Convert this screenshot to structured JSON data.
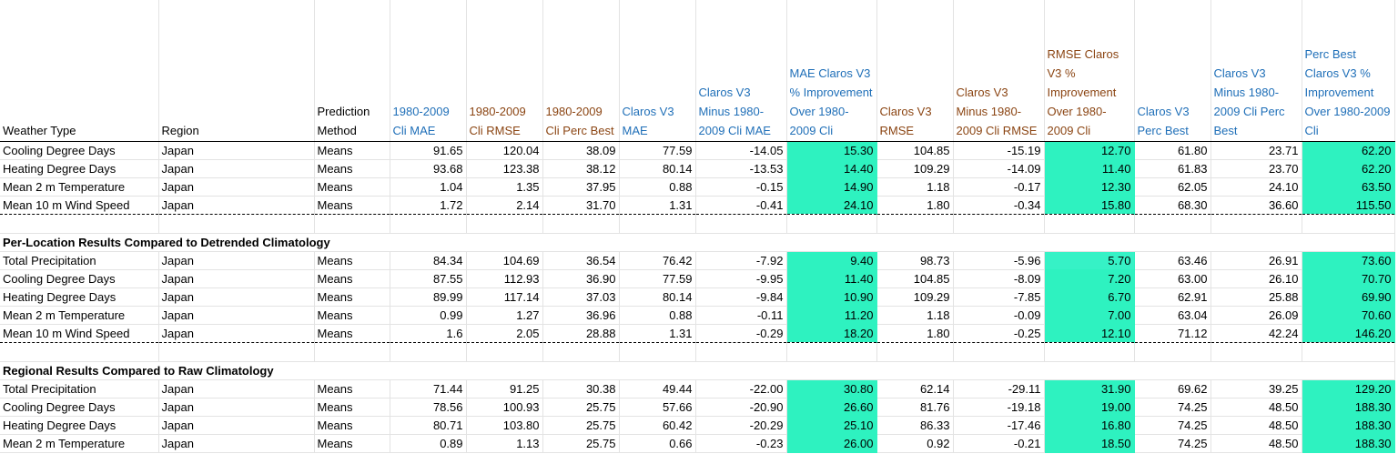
{
  "headers": [
    {
      "text": "Weather Type",
      "color": "black"
    },
    {
      "text": "Region",
      "color": "black"
    },
    {
      "text": "Prediction Method",
      "color": "black"
    },
    {
      "text": "1980-2009 Cli MAE",
      "color": "blue"
    },
    {
      "text": "1980-2009 Cli RMSE",
      "color": "brown"
    },
    {
      "text": "1980-2009 Cli Perc Best",
      "color": "brown"
    },
    {
      "text": "Claros V3 MAE",
      "color": "blue"
    },
    {
      "text": "Claros V3 Minus 1980-2009 Cli MAE",
      "color": "blue"
    },
    {
      "text": "MAE Claros V3 % Improvement Over 1980-2009 Cli",
      "color": "blue"
    },
    {
      "text": "Claros V3 RMSE",
      "color": "brown"
    },
    {
      "text": "Claros V3 Minus 1980-2009 Cli RMSE",
      "color": "brown"
    },
    {
      "text": "RMSE Claros V3 % Improvement Over 1980-2009 Cli",
      "color": "brown"
    },
    {
      "text": "Claros V3 Perc Best",
      "color": "blue"
    },
    {
      "text": "Claros V3 Minus 1980-2009 Cli Perc Best",
      "color": "blue"
    },
    {
      "text": "Perc Best Claros V3 % Improvement Over 1980-2009 Cli",
      "color": "blue"
    }
  ],
  "sections": [
    {
      "title": "",
      "rows": [
        [
          "Cooling Degree Days",
          "Japan",
          "Means",
          "91.65",
          "120.04",
          "38.09",
          "77.59",
          "-14.05",
          "15.30",
          "104.85",
          "-15.19",
          "12.70",
          "61.80",
          "23.71",
          "62.20"
        ],
        [
          "Heating Degree Days",
          "Japan",
          "Means",
          "93.68",
          "123.38",
          "38.12",
          "80.14",
          "-13.53",
          "14.40",
          "109.29",
          "-14.09",
          "11.40",
          "61.83",
          "23.70",
          "62.20"
        ],
        [
          "Mean 2 m Temperature",
          "Japan",
          "Means",
          "1.04",
          "1.35",
          "37.95",
          "0.88",
          "-0.15",
          "14.90",
          "1.18",
          "-0.17",
          "12.30",
          "62.05",
          "24.10",
          "63.50"
        ],
        [
          "Mean 10 m Wind Speed",
          "Japan",
          "Means",
          "1.72",
          "2.14",
          "31.70",
          "1.31",
          "-0.41",
          "24.10",
          "1.80",
          "-0.34",
          "15.80",
          "68.30",
          "36.60",
          "115.50"
        ]
      ]
    },
    {
      "title": "Per-Location Results Compared to Detrended Climatology",
      "rows": [
        [
          "Total Precipitation",
          "Japan",
          "Means",
          "84.34",
          "104.69",
          "36.54",
          "76.42",
          "-7.92",
          "9.40",
          "98.73",
          "-5.96",
          "5.70",
          "63.46",
          "26.91",
          "73.60"
        ],
        [
          "Cooling Degree Days",
          "Japan",
          "Means",
          "87.55",
          "112.93",
          "36.90",
          "77.59",
          "-9.95",
          "11.40",
          "104.85",
          "-8.09",
          "7.20",
          "63.00",
          "26.10",
          "70.70"
        ],
        [
          "Heating Degree Days",
          "Japan",
          "Means",
          "89.99",
          "117.14",
          "37.03",
          "80.14",
          "-9.84",
          "10.90",
          "109.29",
          "-7.85",
          "6.70",
          "62.91",
          "25.88",
          "69.90"
        ],
        [
          "Mean 2 m Temperature",
          "Japan",
          "Means",
          "0.99",
          "1.27",
          "36.96",
          "0.88",
          "-0.11",
          "11.20",
          "1.18",
          "-0.09",
          "7.00",
          "63.04",
          "26.09",
          "70.60"
        ],
        [
          "Mean 10 m Wind Speed",
          "Japan",
          "Means",
          "1.6",
          "2.05",
          "28.88",
          "1.31",
          "-0.29",
          "18.20",
          "1.80",
          "-0.25",
          "12.10",
          "71.12",
          "42.24",
          "146.20"
        ]
      ]
    },
    {
      "title": "Regional Results Compared to Raw Climatology",
      "rows": [
        [
          "Total Precipitation",
          "Japan",
          "Means",
          "71.44",
          "91.25",
          "30.38",
          "49.44",
          "-22.00",
          "30.80",
          "62.14",
          "-29.11",
          "31.90",
          "69.62",
          "39.25",
          "129.20"
        ],
        [
          "Cooling Degree Days",
          "Japan",
          "Means",
          "78.56",
          "100.93",
          "25.75",
          "57.66",
          "-20.90",
          "26.60",
          "81.76",
          "-19.18",
          "19.00",
          "74.25",
          "48.50",
          "188.30"
        ],
        [
          "Heating Degree Days",
          "Japan",
          "Means",
          "80.71",
          "103.80",
          "25.75",
          "60.42",
          "-20.29",
          "25.10",
          "86.33",
          "-17.46",
          "16.80",
          "74.25",
          "48.50",
          "188.30"
        ],
        [
          "Mean 2 m Temperature",
          "Japan",
          "Means",
          "0.89",
          "1.13",
          "25.75",
          "0.66",
          "-0.23",
          "26.00",
          "0.92",
          "-0.21",
          "18.50",
          "74.25",
          "48.50",
          "188.30"
        ]
      ]
    }
  ],
  "colors": {
    "highlight": "#2ef2c0",
    "header_blue": "#1f6fb8",
    "header_brown": "#8b4513"
  }
}
